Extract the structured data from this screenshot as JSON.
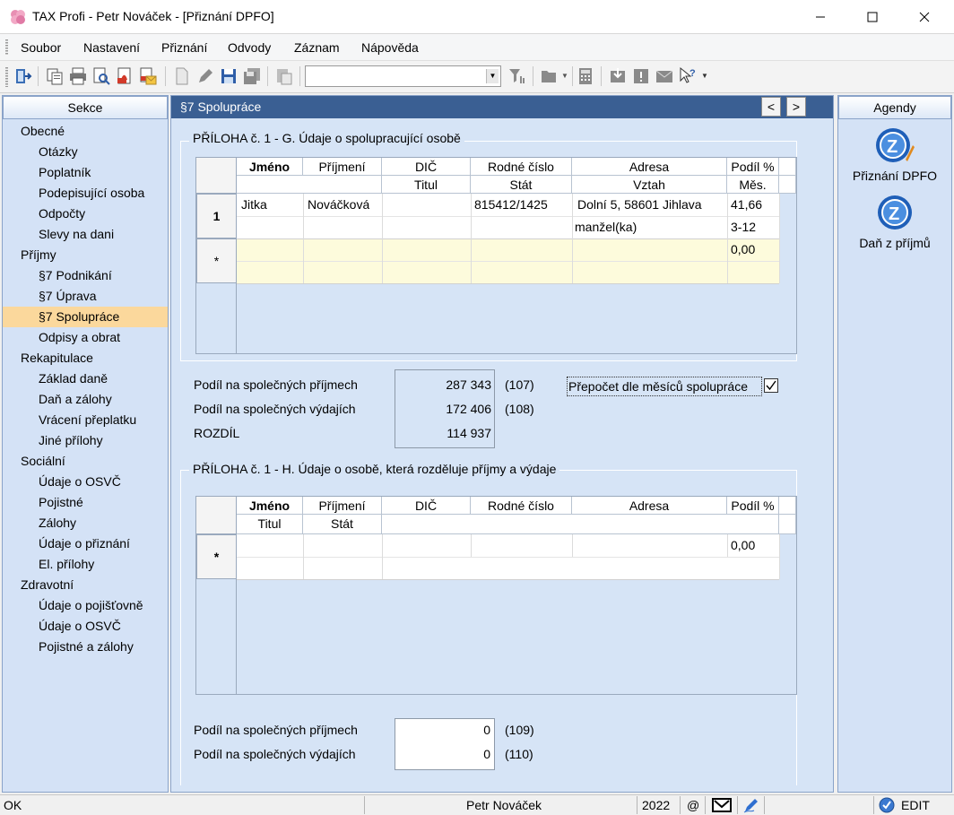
{
  "window": {
    "title": "TAX Profi - Petr Nováček - [Přiznání DPFO]"
  },
  "menu": [
    "Soubor",
    "Nastavení",
    "Přiznání",
    "Odvody",
    "Záznam",
    "Nápověda"
  ],
  "left_panel": {
    "title": "Sekce",
    "items": [
      {
        "label": "Obecné",
        "level": 0
      },
      {
        "label": "Otázky",
        "level": 1
      },
      {
        "label": "Poplatník",
        "level": 1
      },
      {
        "label": "Podepisující osoba",
        "level": 1
      },
      {
        "label": "Odpočty",
        "level": 1
      },
      {
        "label": "Slevy na dani",
        "level": 1
      },
      {
        "label": "Příjmy",
        "level": 0
      },
      {
        "label": "§7 Podnikání",
        "level": 1
      },
      {
        "label": "§7 Úprava",
        "level": 1
      },
      {
        "label": "§7 Spolupráce",
        "level": 1,
        "selected": true
      },
      {
        "label": "Odpisy a obrat",
        "level": 1
      },
      {
        "label": "Rekapitulace",
        "level": 0
      },
      {
        "label": "Základ daně",
        "level": 1
      },
      {
        "label": "Daň a zálohy",
        "level": 1
      },
      {
        "label": "Vrácení přeplatku",
        "level": 1
      },
      {
        "label": "Jiné přílohy",
        "level": 1
      },
      {
        "label": "Sociální",
        "level": 0
      },
      {
        "label": "Údaje o OSVČ",
        "level": 1
      },
      {
        "label": "Pojistné",
        "level": 1
      },
      {
        "label": "Zálohy",
        "level": 1
      },
      {
        "label": "Údaje o přiznání",
        "level": 1
      },
      {
        "label": "El. přílohy",
        "level": 1
      },
      {
        "label": "Zdravotní",
        "level": 0
      },
      {
        "label": "Údaje o pojišťovně",
        "level": 1
      },
      {
        "label": "Údaje o OSVČ",
        "level": 1
      },
      {
        "label": "Pojistné a zálohy",
        "level": 1
      }
    ]
  },
  "center": {
    "title": "§7 Spolupráce",
    "prev": "<",
    "next": ">",
    "section_g": {
      "title": "PŘÍLOHA č. 1 - G. Údaje o spolupracující osobě",
      "headers_row1": [
        "Jméno",
        "Příjmení",
        "DIČ",
        "Rodné číslo",
        "Adresa",
        "Podíl %"
      ],
      "headers_row2": [
        "Titul",
        "Stát",
        "Vztah",
        "Měs."
      ],
      "rows": [
        {
          "num": "1",
          "jmeno": "Jitka",
          "prijmeni": "Nováčková",
          "dic": "",
          "rc": "815412/1425",
          "adresa": "Dolní 5, 58601 Jihlava",
          "podil": "41,66",
          "vztah": "manžel(ka)",
          "mes": "3-12"
        },
        {
          "num": "*",
          "podil": "0,00"
        }
      ]
    },
    "summary_g": {
      "income_label": "Podíl na společných příjmech",
      "income_value": "287 343",
      "income_code": "(107)",
      "expense_label": "Podíl na společných výdajích",
      "expense_value": "172 406",
      "expense_code": "(108)",
      "diff_label": "ROZDÍL",
      "diff_value": "114 937",
      "checkbox_label": "Přepočet dle měsíců spolupráce",
      "checkbox_checked": true
    },
    "section_h": {
      "title": "PŘÍLOHA č. 1 - H. Údaje o osobě, která rozděluje příjmy a výdaje",
      "headers_row1": [
        "Jméno",
        "Příjmení",
        "DIČ",
        "Rodné číslo",
        "Adresa",
        "Podíl %"
      ],
      "headers_row2": [
        "Titul",
        "Stát"
      ],
      "rows": [
        {
          "num": "*",
          "podil": "0,00"
        }
      ]
    },
    "summary_h": {
      "income_label": "Podíl na společných příjmech",
      "income_value": "0",
      "income_code": "(109)",
      "expense_label": "Podíl na společných výdajích",
      "expense_value": "0",
      "expense_code": "(110)"
    }
  },
  "right_panel": {
    "title": "Agendy",
    "items": [
      "Přiznání DPFO",
      "Daň z příjmů"
    ]
  },
  "status": {
    "left": "OK",
    "user": "Petr Nováček",
    "year": "2022",
    "at": "@",
    "mode": "EDIT"
  },
  "colors": {
    "header_bar": "#3a5f93",
    "selected_item": "#fbd89c",
    "panel_bg": "#d6e4f6",
    "new_row": "#fdfbdc"
  }
}
